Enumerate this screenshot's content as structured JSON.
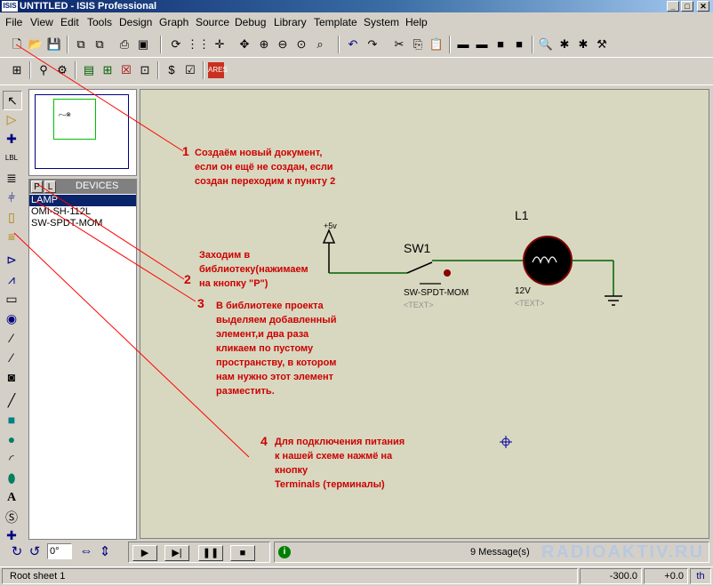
{
  "window": {
    "app_icon_text": "ISIS",
    "title": "UNTITLED - ISIS Professional"
  },
  "menu": [
    "File",
    "View",
    "Edit",
    "Tools",
    "Design",
    "Graph",
    "Source",
    "Debug",
    "Library",
    "Template",
    "System",
    "Help"
  ],
  "device_panel": {
    "pick_button": "P",
    "library_button": "L",
    "header": "DEVICES",
    "items": [
      "LAMP",
      "OMI-SH-112L",
      "SW-SPDT-MOM"
    ],
    "selected_index": 0
  },
  "schematic": {
    "power_label": "+5v",
    "switch_ref": "SW1",
    "switch_part": "SW-SPDT-MOM",
    "switch_text": "<TEXT>",
    "lamp_ref": "L1",
    "lamp_value": "12V",
    "lamp_text": "<TEXT>"
  },
  "annotations": [
    {
      "num": "1",
      "text": "Создаём новый документ,\nесли он ещё не создан, если\nсоздан переходим к пункту 2"
    },
    {
      "num": "2",
      "text": "Заходим в\nбиблиотеку(нажимаем\nна кнопку \"P\")"
    },
    {
      "num": "3",
      "text": "В библиотеке проекта\nвыделяем добавленный\nэлемент,и два раза\nкликаем по пустому\nпространству, в котором\nнам нужно этот элемент\nразместить."
    },
    {
      "num": "4",
      "text": "Для подключения питания\nк нашей схеме нажмё на\nкнопку\nTerminals (терминалы)"
    }
  ],
  "bottom": {
    "rotation_value": "0°",
    "messages": "9 Message(s)",
    "watermark": "RADIOAKTIV.RU"
  },
  "status": {
    "sheet": "Root sheet 1",
    "x_coord": "-300.0",
    "y_coord": "+0.0",
    "units": "th"
  },
  "colors": {
    "annotation": "#cc0000",
    "wire": "#006000",
    "selected": "#0a246a",
    "canvas": "#d8d8c0"
  }
}
